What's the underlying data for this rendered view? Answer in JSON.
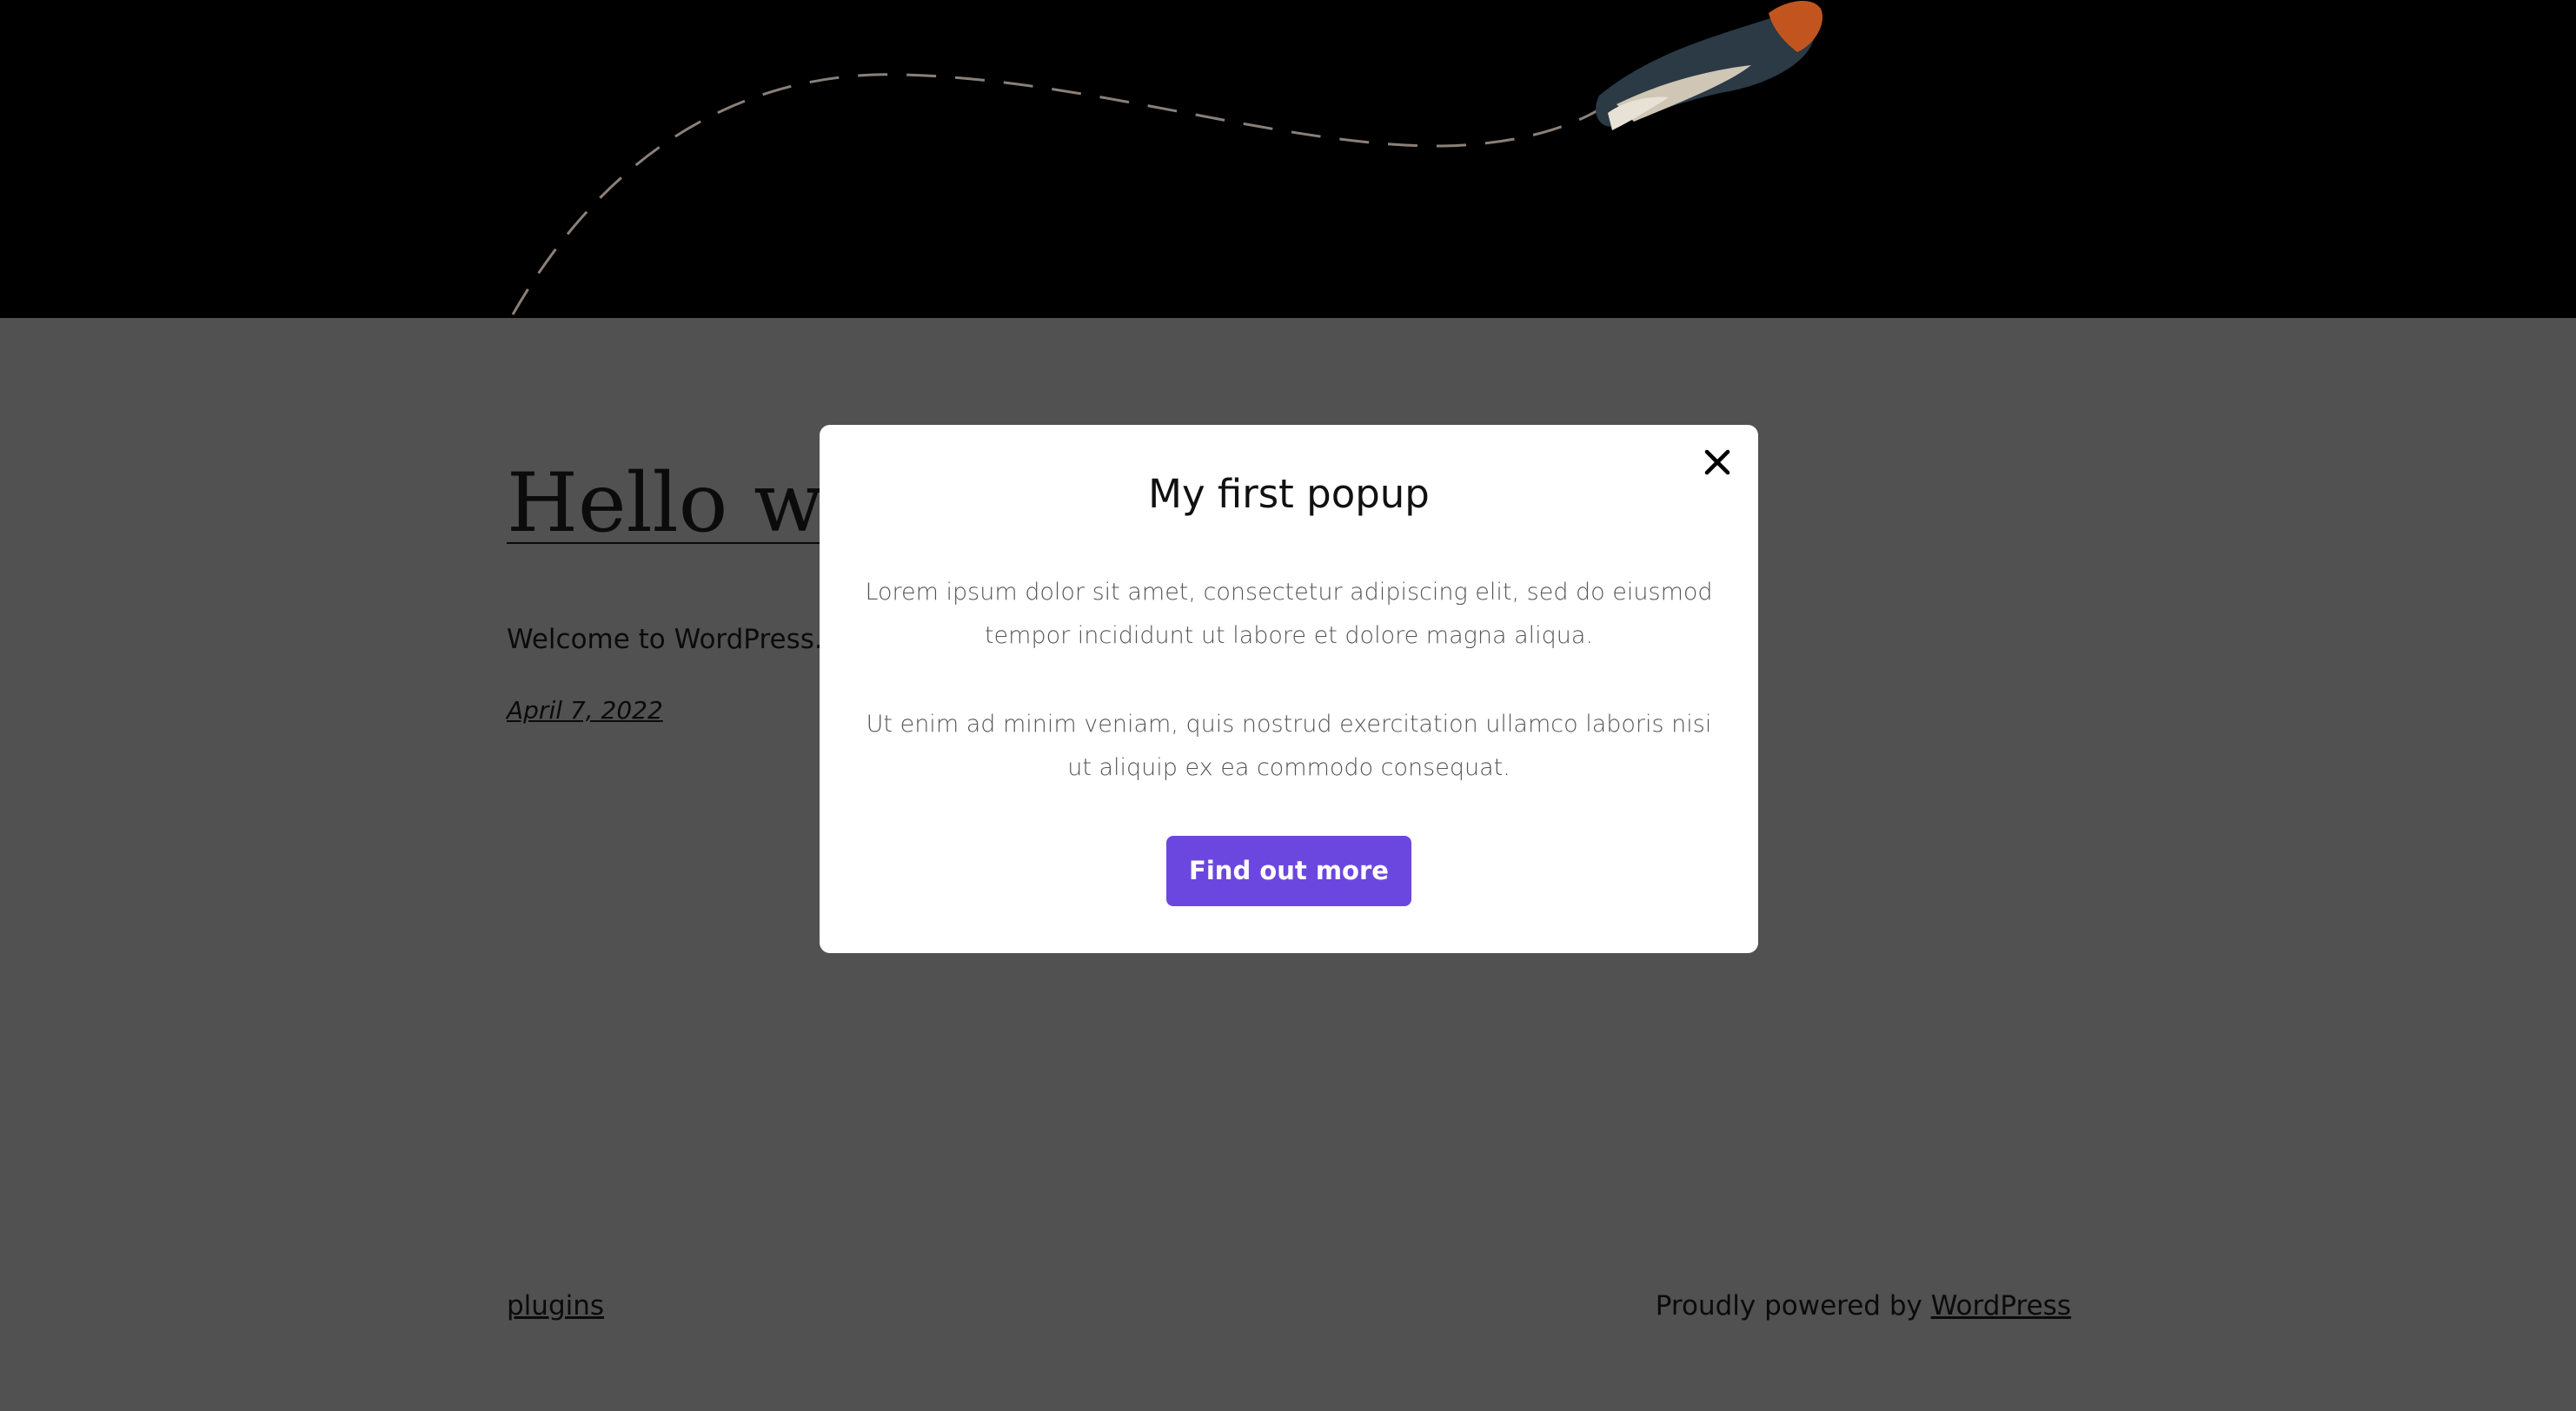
{
  "colors": {
    "header_bg": "#000000",
    "page_overlay_bg": "#515151",
    "popup_bg": "#ffffff",
    "button_bg": "#6c47df",
    "button_text": "#ffffff"
  },
  "post": {
    "title": "Hello wor",
    "excerpt": "Welcome to WordPress. T",
    "date": "April 7, 2022"
  },
  "popup": {
    "close_icon": "close-icon",
    "title": "My first popup",
    "paragraph_1": "Lorem ipsum dolor sit amet, consectetur adipiscing elit, sed do eiusmod tempor incididunt ut labore et dolore magna aliqua.",
    "paragraph_2": "Ut enim ad minim veniam, quis nostrud exercitation ullamco laboris nisi ut aliquip ex ea commodo consequat.",
    "button_label": "Find out more"
  },
  "footer": {
    "left_link": "plugins",
    "powered_prefix": "Proudly powered by ",
    "powered_link": "WordPress"
  }
}
